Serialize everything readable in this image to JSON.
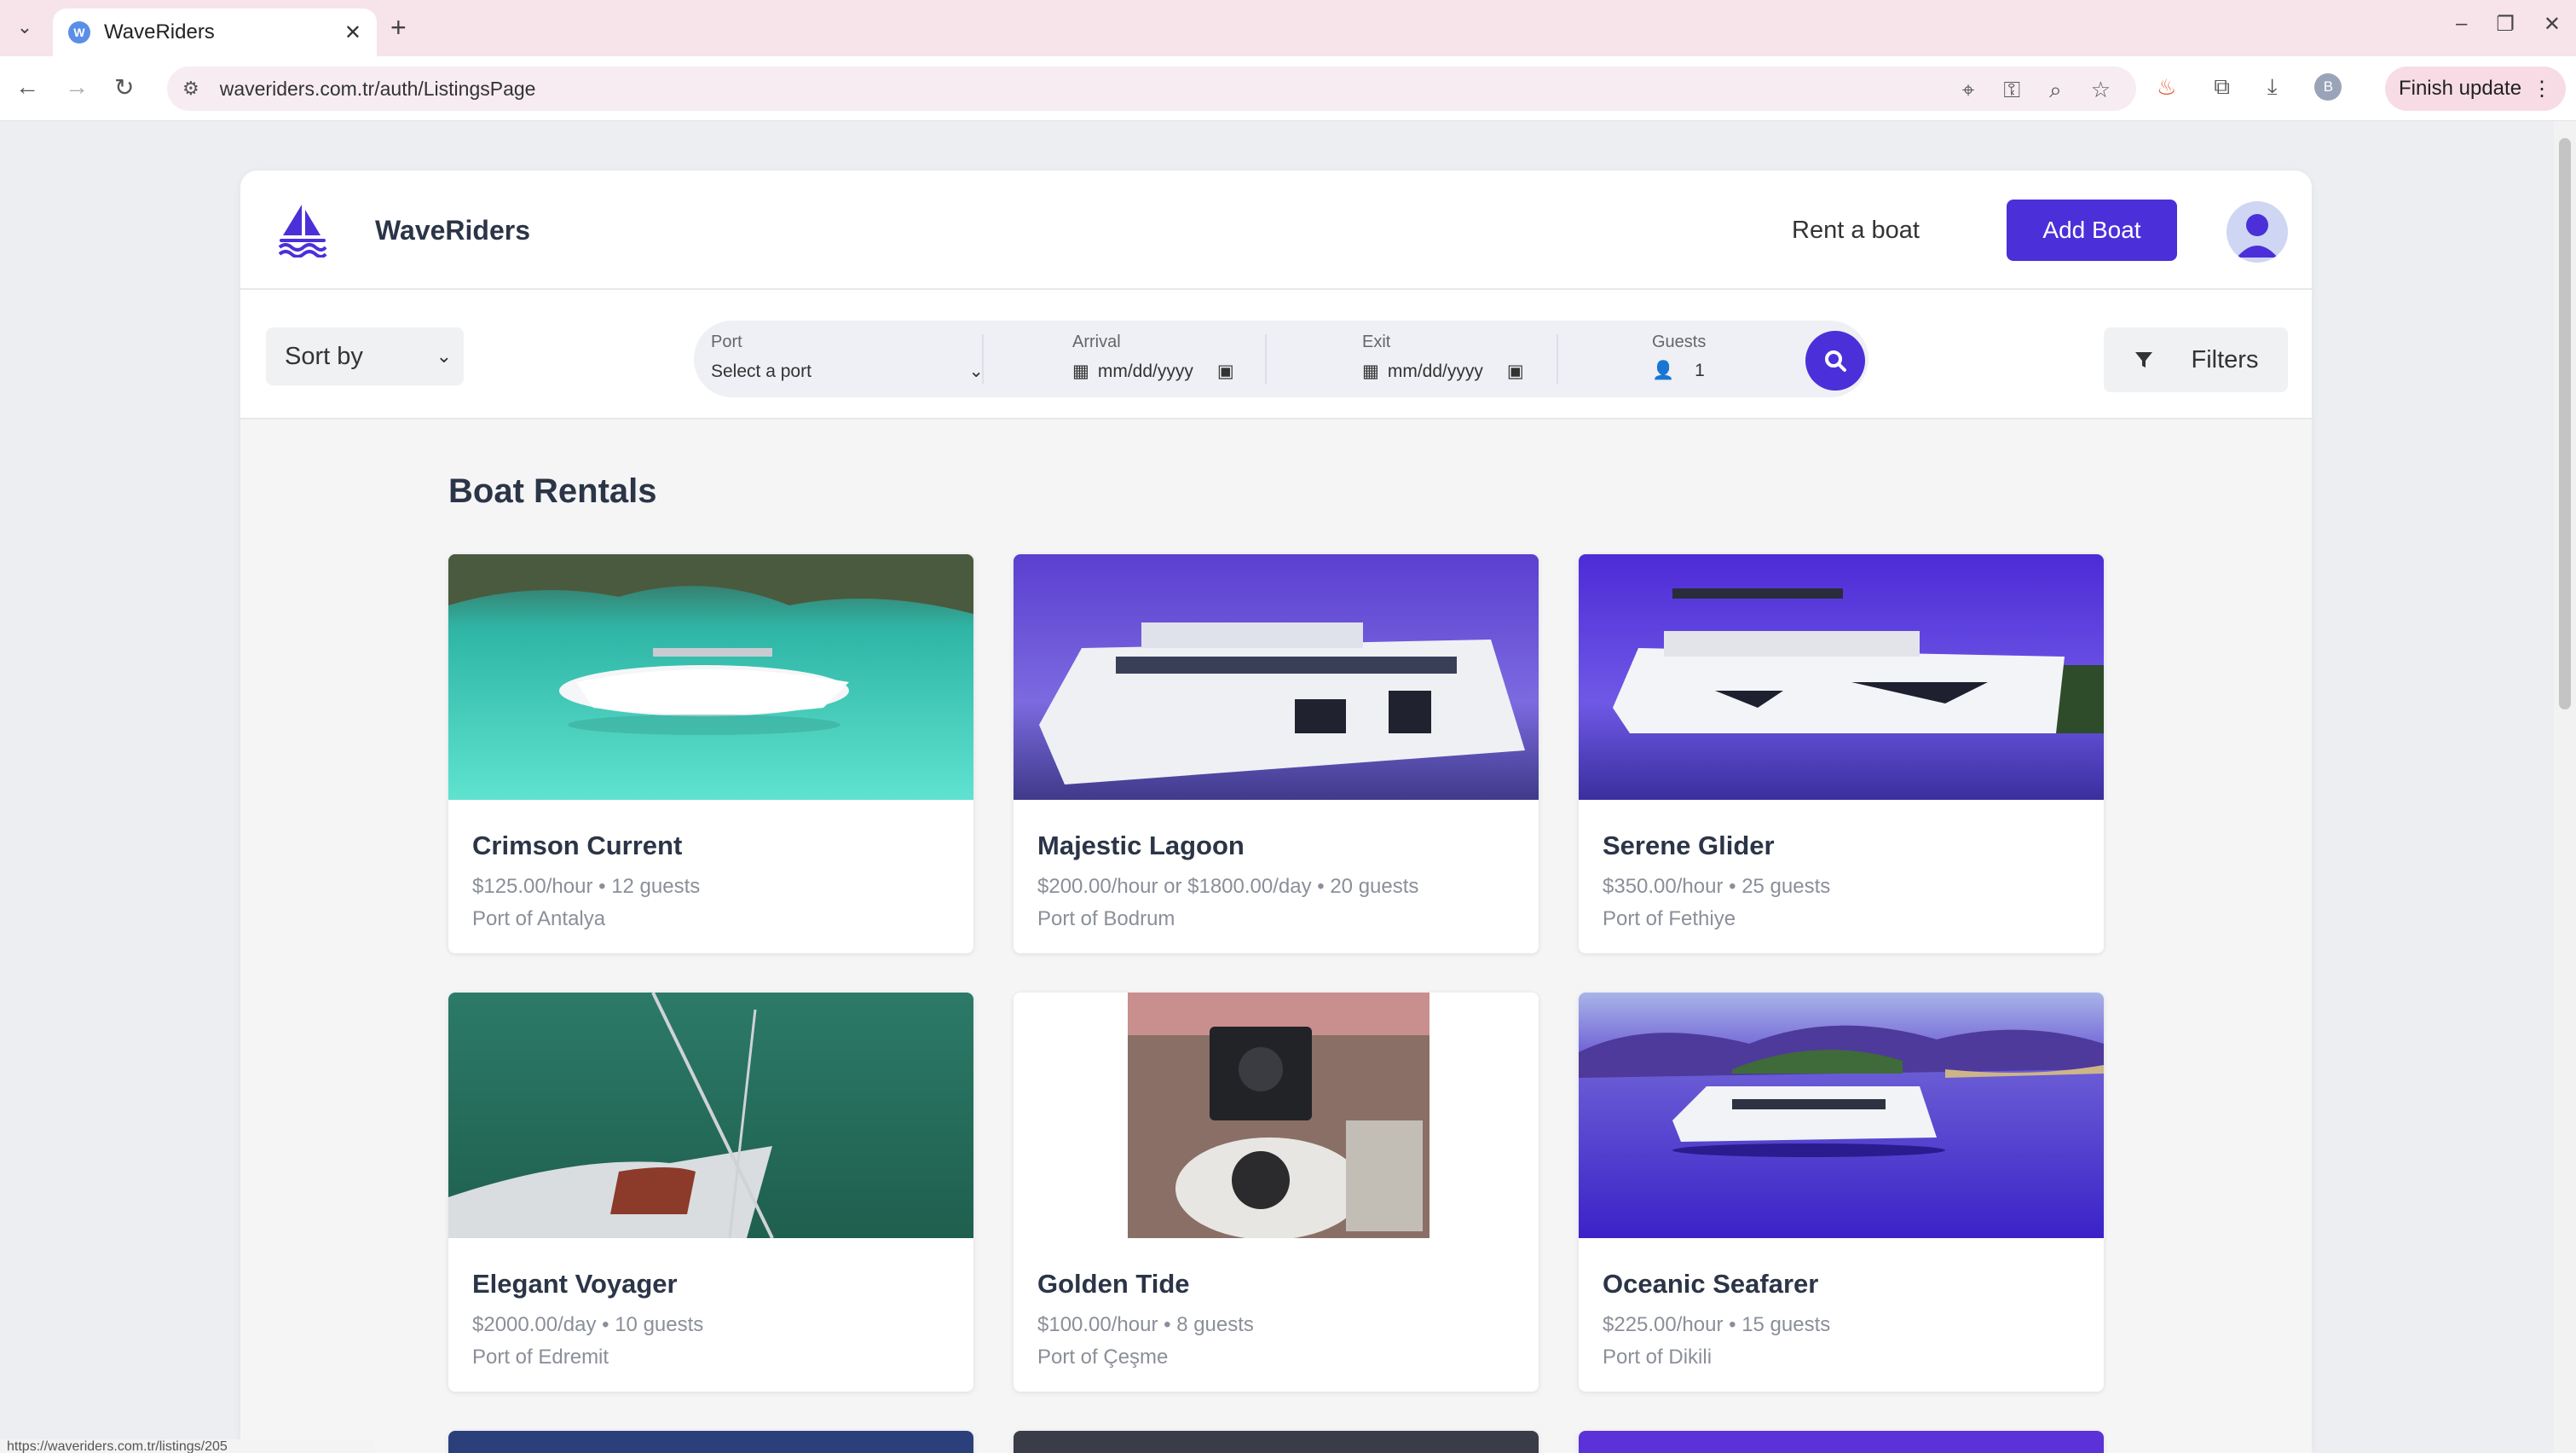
{
  "browser": {
    "tab_title": "WaveRiders",
    "tab_favicon": "W",
    "url": "waveriders.com.tr/auth/ListingsPage",
    "finish_update_label": "Finish update",
    "profile_initial": "B",
    "status_url": "https://waveriders.com.tr/listings/205"
  },
  "header": {
    "brand": "WaveRiders",
    "rent_link": "Rent a boat",
    "add_boat_label": "Add Boat"
  },
  "search": {
    "sort_label": "Sort by",
    "port_label": "Port",
    "port_value": "Select a port",
    "arrival_label": "Arrival",
    "arrival_placeholder": "mm/dd/yyyy",
    "exit_label": "Exit",
    "exit_placeholder": "mm/dd/yyyy",
    "guests_label": "Guests",
    "guests_value": "1",
    "filters_label": "Filters"
  },
  "main": {
    "section_title": "Boat Rentals",
    "listings": [
      {
        "name": "Crimson Current",
        "meta": "$125.00/hour • 12 guests",
        "port": "Port of Antalya"
      },
      {
        "name": "Majestic Lagoon",
        "meta": "$200.00/hour or $1800.00/day • 20 guests",
        "port": "Port of Bodrum"
      },
      {
        "name": "Serene Glider",
        "meta": "$350.00/hour • 25 guests",
        "port": "Port of Fethiye"
      },
      {
        "name": "Elegant Voyager",
        "meta": "$2000.00/day • 10 guests",
        "port": "Port of Edremit"
      },
      {
        "name": "Golden Tide",
        "meta": "$100.00/hour • 8 guests",
        "port": "Port of Çeşme"
      },
      {
        "name": "Oceanic Seafarer",
        "meta": "$225.00/hour • 15 guests",
        "port": "Port of Dikili"
      }
    ]
  },
  "colors": {
    "accent": "#4b30d9",
    "tabbar": "#f7e3ea",
    "page_bg": "#eceef1"
  }
}
